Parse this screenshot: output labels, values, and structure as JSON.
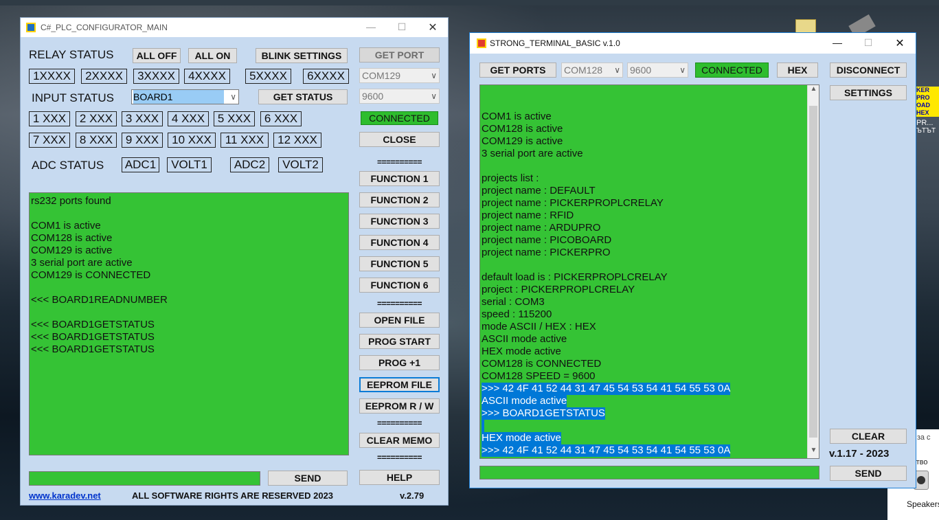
{
  "left_window": {
    "title": "C#_PLC_CONFIGURATOR_MAIN",
    "relay_status_label": "RELAY STATUS",
    "all_off": "ALL OFF",
    "all_on": "ALL ON",
    "blink_settings": "BLINK SETTINGS",
    "get_port": "GET PORT",
    "relays": [
      "1XXXX",
      "2XXXX",
      "3XXXX",
      "4XXXX",
      "5XXXX",
      "6XXXX"
    ],
    "port_combo": "COM129",
    "input_status_label": "INPUT STATUS",
    "board_combo": "BOARD1",
    "get_status": "GET STATUS",
    "baud_combo": "9600",
    "inputs_row1": [
      "1 XXX",
      "2 XXX",
      "3 XXX",
      "4 XXX",
      "5 XXX",
      "6 XXX"
    ],
    "inputs_row2": [
      "7 XXX",
      "8 XXX",
      "9 XXX",
      "10 XXX",
      "11 XXX",
      "12 XXX"
    ],
    "connected": "CONNECTED",
    "close": "CLOSE",
    "adc_status_label": "ADC STATUS",
    "adc": [
      "ADC1",
      "VOLT1",
      "ADC2",
      "VOLT2"
    ],
    "separator": "==========",
    "functions": [
      "FUNCTION 1",
      "FUNCTION 2",
      "FUNCTION 3",
      "FUNCTION 4",
      "FUNCTION 5",
      "FUNCTION 6"
    ],
    "open_file": "OPEN FILE",
    "prog_start": "PROG START",
    "prog_plus": "PROG +1",
    "eeprom_file": "EEPROM FILE",
    "eeprom_rw": "EEPROM R / W",
    "clear_memo": "CLEAR MEMO",
    "help": "HELP",
    "send": "SEND",
    "memo_lines": [
      "rs232 ports found",
      "",
      "COM1 is active",
      "COM128 is active",
      "COM129 is active",
      "3 serial port are active",
      "COM129 is CONNECTED",
      "",
      "<<< BOARD1READNUMBER",
      "",
      "<<< BOARD1GETSTATUS",
      "<<< BOARD1GETSTATUS",
      "<<< BOARD1GETSTATUS"
    ],
    "footer_link": "www.karadev.net",
    "footer_rights": "ALL SOFTWARE RIGHTS ARE RESERVED 2023",
    "footer_version": "v.2.79"
  },
  "right_window": {
    "title": "STRONG_TERMINAL_BASIC v.1.0",
    "get_ports": "GET PORTS",
    "port_combo": "COM128",
    "baud_combo": "9600",
    "connected": "CONNECTED",
    "hex": "HEX",
    "disconnect": "DISCONNECT",
    "settings": "SETTINGS",
    "clear": "CLEAR",
    "version": "v.1.17 - 2023",
    "send": "SEND",
    "memo_lines": [
      "",
      "COM1 is active",
      "COM128 is active",
      "COM129 is active",
      "3 serial port are active",
      "",
      "projects list :",
      "project name : DEFAULT",
      "project name : PICKERPROPLCRELAY",
      "project name : RFID",
      "project name : ARDUPRO",
      "project name : PICOBOARD",
      "project name : PICKERPRO",
      "",
      "default load is : PICKERPROPLCRELAY",
      "project : PICKERPROPLCRELAY",
      "serial : COM3",
      "speed : 115200",
      "mode ASCII / HEX : HEX",
      "ASCII mode active",
      "HEX mode active",
      "COM128 is CONNECTED",
      "COM128 SPEED = 9600"
    ],
    "memo_selected": [
      ">>> 42 4F 41 52 44 31 47 45 54 53 54 41 54 55 53 0A",
      "ASCII mode active",
      ">>> BOARD1GETSTATUS",
      " ",
      "HEX mode active",
      ">>> 42 4F 41 52 44 31 47 45 54 53 54 41 54 55 53 0A"
    ]
  },
  "desktop": {
    "partial_labels": [
      "KER",
      "PRO",
      "OAD",
      "HEX",
      "PR...",
      "ЪТЪТ"
    ],
    "partial_text_1": "er за с",
    "partial_text_2": "йство",
    "speakers": "Speakers"
  },
  "colors": {
    "window_bg": "#c7daf0",
    "memo_green": "#35c335",
    "connected_green": "#2ebd2e",
    "selection_blue": "#0078d7"
  }
}
